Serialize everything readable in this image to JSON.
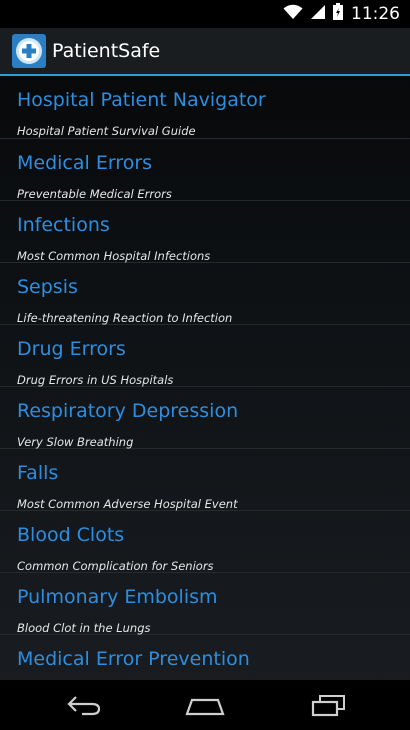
{
  "status_bar": {
    "time": "11:26",
    "icons": [
      "wifi-icon",
      "signal-icon",
      "battery-icon"
    ]
  },
  "action_bar": {
    "app_name": "PatientSafe",
    "app_icon": "patientsafe-logo-icon"
  },
  "items": [
    {
      "title": "Hospital Patient Navigator",
      "subtitle": "Hospital Patient Survival Guide"
    },
    {
      "title": "Medical Errors",
      "subtitle": "Preventable Medical Errors"
    },
    {
      "title": "Infections",
      "subtitle": "Most Common Hospital Infections"
    },
    {
      "title": "Sepsis",
      "subtitle": "Life-threatening Reaction to Infection"
    },
    {
      "title": "Drug Errors",
      "subtitle": "Drug Errors in US Hospitals"
    },
    {
      "title": "Respiratory Depression",
      "subtitle": "Very Slow Breathing"
    },
    {
      "title": "Falls",
      "subtitle": "Most Common Adverse Hospital Event"
    },
    {
      "title": "Blood Clots",
      "subtitle": "Common Complication for Seniors"
    },
    {
      "title": "Pulmonary Embolism",
      "subtitle": "Blood Clot in the Lungs"
    },
    {
      "title": "Medical Error Prevention",
      "subtitle": ""
    }
  ],
  "nav_bar": {
    "buttons": [
      "back-icon",
      "home-icon",
      "recents-icon"
    ]
  },
  "colors": {
    "accent": "#2f9fd0",
    "item_title": "#2d8ee0",
    "action_bar_bg": "#1a1d20"
  }
}
